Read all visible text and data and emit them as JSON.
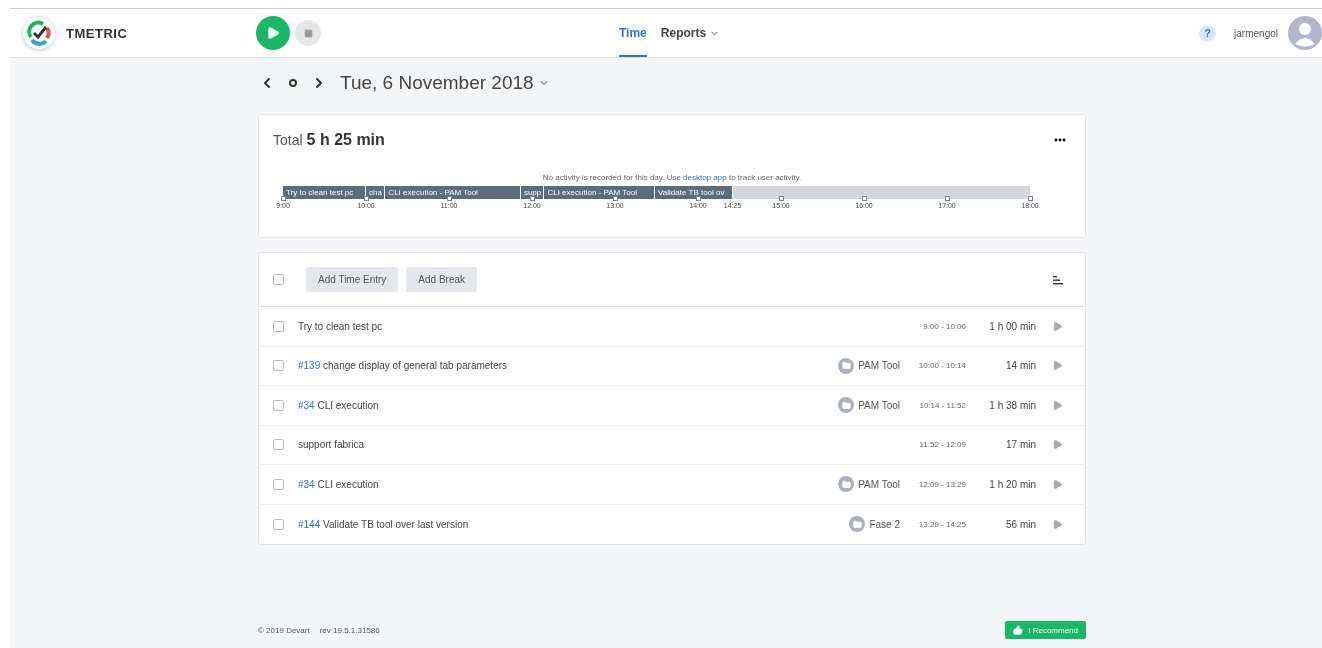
{
  "header": {
    "brand": "TMETRIC",
    "nav": [
      {
        "label": "Time",
        "selected": true,
        "dropdown": false
      },
      {
        "label": "Reports",
        "selected": false,
        "dropdown": true
      }
    ],
    "help": "?",
    "user": "jarmengol"
  },
  "date": {
    "label": "Tue, 6 November 2018"
  },
  "summary": {
    "total_label": "Total",
    "total": "5 h 25 min",
    "notice": "No activity is recorded for this day. Use",
    "notice_link": "desktop app",
    "notice_end": "to track user activity.",
    "timeline": {
      "segments": [
        {
          "label": "Try to clean test pc"
        },
        {
          "label": "cha"
        },
        {
          "label": "CLI execution - PAM Tool"
        },
        {
          "label": "supp"
        },
        {
          "label": "CLI execution - PAM Tool"
        },
        {
          "label": "Validate TB tool ov"
        }
      ],
      "ticks": [
        {
          "label": "9:00",
          "marker": true
        },
        {
          "label": "10:00",
          "marker": true
        },
        {
          "label": "11:00",
          "marker": true
        },
        {
          "label": "12:00",
          "marker": true
        },
        {
          "label": "13:00",
          "marker": true
        },
        {
          "label": "14:00",
          "marker": true
        },
        {
          "label": "14:25",
          "marker": false
        },
        {
          "label": "15:00",
          "marker": true
        },
        {
          "label": "16:00",
          "marker": true
        },
        {
          "label": "17:00",
          "marker": true
        },
        {
          "label": "18:00",
          "marker": true
        }
      ]
    }
  },
  "entries_toolbar": {
    "buttons": [
      "Add Time Entry",
      "Add Break"
    ],
    "checked": false
  },
  "entries": [
    {
      "title": "Try to clean test pc",
      "range": "9:00 - 10:00",
      "duration": "1 h 00 min",
      "checked": false
    },
    {
      "issue": "#139",
      "title": "change display of general tab parameters",
      "project": "PAM Tool",
      "range": "10:00 - 10:14",
      "duration": "14 min",
      "checked": false
    },
    {
      "issue": "#34",
      "title": "CLI execution",
      "project": "PAM Tool",
      "range": "10:14 - 11:52",
      "duration": "1 h 38 min",
      "checked": false
    },
    {
      "title": "support fabrica",
      "range": "11:52 - 12:09",
      "duration": "17 min",
      "checked": false
    },
    {
      "issue": "#34",
      "title": "CLI execution",
      "project": "PAM Tool",
      "range": "12:09 - 13:29",
      "duration": "1 h 20 min",
      "checked": false
    },
    {
      "issue": "#144",
      "title": "Validate TB tool over last version",
      "project": "Fase 2",
      "range": "13:29 - 14:25",
      "duration": "56 min",
      "checked": false
    }
  ],
  "footer": {
    "copyright": "© 2019 Devart",
    "revision": "rev 19.5.1.31586",
    "recommend": "I Recommend"
  }
}
